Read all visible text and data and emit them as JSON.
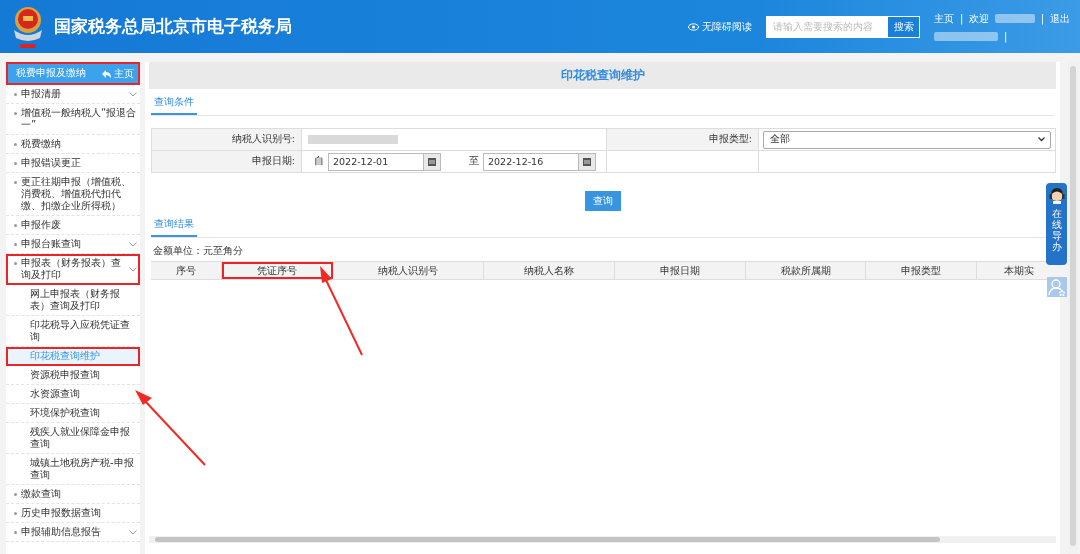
{
  "header": {
    "title": "国家税务总局北京市电子税务局",
    "accessibility": "无障碍阅读",
    "search": {
      "placeholder": "请输入需要搜索的内容",
      "button": "搜索"
    },
    "links": [
      {
        "kind": "link",
        "label": "主页"
      },
      {
        "kind": "sep",
        "label": "|"
      },
      {
        "kind": "link",
        "label": "欢迎"
      },
      {
        "kind": "redacted"
      },
      {
        "kind": "sep",
        "label": "|"
      },
      {
        "kind": "link",
        "label": "退出"
      }
    ],
    "second_line": [
      {
        "kind": "redacted"
      },
      {
        "kind": "sep",
        "label": "|"
      }
    ]
  },
  "sidebar": {
    "title": "税费申报及缴纳",
    "home": "主页",
    "highlighted": true,
    "items": [
      {
        "label": "申报清册",
        "expandable": true,
        "highlighted": false
      },
      {
        "label": "增值税一般纳税人“报退合一”",
        "expandable": false,
        "highlighted": false
      },
      {
        "label": "税费缴纳",
        "expandable": false,
        "highlighted": false
      },
      {
        "label": "申报错误更正",
        "expandable": false,
        "highlighted": false
      },
      {
        "label": "更正往期申报（增值税、消费税、增值税代扣代缴、扣缴企业所得税）",
        "expandable": false,
        "highlighted": false
      },
      {
        "label": "申报作废",
        "expandable": false,
        "highlighted": false
      },
      {
        "label": "申报台账查询",
        "expandable": true,
        "highlighted": false
      },
      {
        "label": "申报表（财务报表）查询及打印",
        "expandable": true,
        "highlighted": true,
        "children": [
          {
            "label": "网上申报表（财务报表）查询及打印",
            "selected": false,
            "highlighted": false
          },
          {
            "label": "印花税导入应税凭证查询",
            "selected": false,
            "highlighted": false
          },
          {
            "label": "印花税查询维护",
            "selected": true,
            "highlighted": true
          },
          {
            "label": "资源税申报查询",
            "selected": false,
            "highlighted": false
          },
          {
            "label": "水资源查询",
            "selected": false,
            "highlighted": false
          },
          {
            "label": "环境保护税查询",
            "selected": false,
            "highlighted": false
          },
          {
            "label": "残疾人就业保障金申报查询",
            "selected": false,
            "highlighted": false
          },
          {
            "label": "城镇土地税房产税-申报查询",
            "selected": false,
            "highlighted": false
          }
        ]
      },
      {
        "label": "缴款查询",
        "expandable": false,
        "highlighted": false
      },
      {
        "label": "历史申报数据查询",
        "expandable": false,
        "highlighted": false
      },
      {
        "label": "申报辅助信息报告",
        "expandable": true,
        "highlighted": false
      }
    ]
  },
  "page_title": "印花税查询维护",
  "conditions_tab": "查询条件",
  "form": {
    "taxpayer_id_label": "纳税人识别号:",
    "taxpayer_id_redacted": true,
    "type_label": "申报类型:",
    "type_value": "全部",
    "date_label": "申报日期:",
    "from_label": "自",
    "from_value": "2022-12-01",
    "to_label": "至",
    "to_value": "2022-12-16"
  },
  "query_button": "查询",
  "results_tab": "查询结果",
  "unit_note": "金额单位：元至角分",
  "table": {
    "columns": [
      {
        "label": "序号",
        "highlighted": false
      },
      {
        "label": "凭证序号",
        "highlighted": true
      },
      {
        "label": "纳税人识别号",
        "highlighted": false
      },
      {
        "label": "纳税人名称",
        "highlighted": false
      },
      {
        "label": "申报日期",
        "highlighted": false
      },
      {
        "label": "税款所属期",
        "highlighted": false
      },
      {
        "label": "申报类型",
        "highlighted": false
      },
      {
        "label": "本期实",
        "highlighted": false
      }
    ]
  },
  "helper_widget": "在线导办"
}
